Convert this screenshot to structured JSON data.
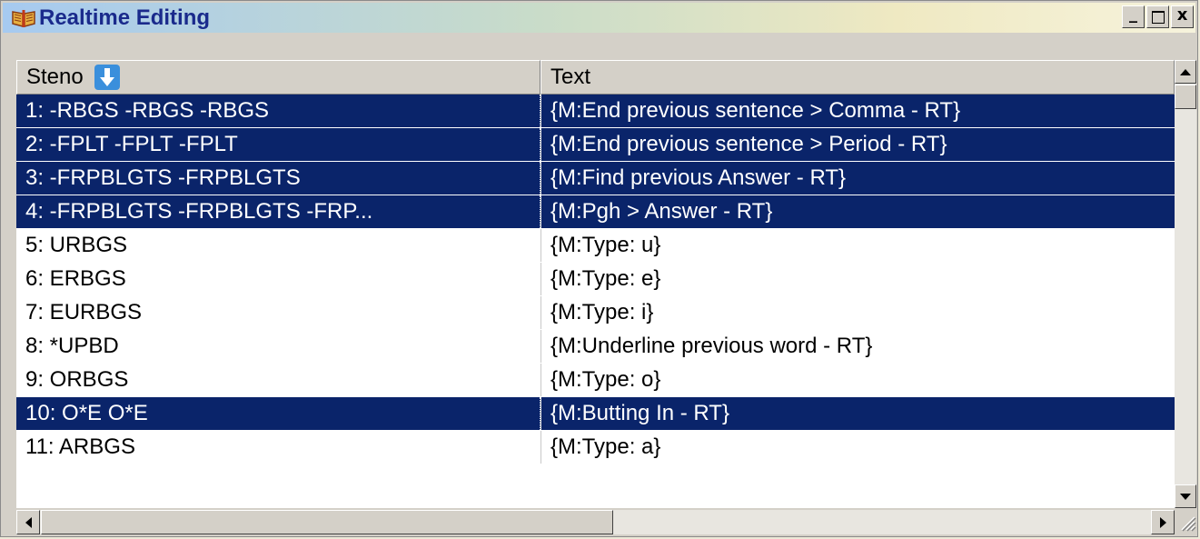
{
  "window": {
    "title": "Realtime Editing",
    "icon": "book-icon",
    "controls": {
      "minimize": "_",
      "maximize": "□",
      "close": "x"
    }
  },
  "columns": {
    "steno": "Steno",
    "text": "Text",
    "sort_icon": "sort-down-arrow-icon"
  },
  "rows": [
    {
      "steno": "1: -RBGS -RBGS -RBGS",
      "text": "{M:End previous sentence > Comma - RT}",
      "selected": true
    },
    {
      "steno": "2: -FPLT -FPLT -FPLT",
      "text": "{M:End previous sentence > Period - RT}",
      "selected": true
    },
    {
      "steno": "3: -FRPBLGTS -FRPBLGTS",
      "text": "{M:Find previous Answer - RT}",
      "selected": true
    },
    {
      "steno": "4: -FRPBLGTS -FRPBLGTS -FRP...",
      "text": "{M:Pgh > Answer - RT}",
      "selected": true
    },
    {
      "steno": "5: URBGS",
      "text": "{M:Type:  u}",
      "selected": false
    },
    {
      "steno": "6: ERBGS",
      "text": "{M:Type:  e}",
      "selected": false
    },
    {
      "steno": "7: EURBGS",
      "text": "{M:Type:  i}",
      "selected": false
    },
    {
      "steno": "8: *UPBD",
      "text": "{M:Underline previous word - RT}",
      "selected": false
    },
    {
      "steno": "9: ORBGS",
      "text": "{M:Type:  o}",
      "selected": false
    },
    {
      "steno": "10: O*E O*E",
      "text": "{M:Butting In - RT}",
      "selected": true
    },
    {
      "steno": "11: ARBGS",
      "text": "{M:Type:  a}",
      "selected": false
    }
  ],
  "colors": {
    "selection": "#0a246a",
    "title_text": "#1a2a8c",
    "sort_icon": "#3a8fdc"
  }
}
